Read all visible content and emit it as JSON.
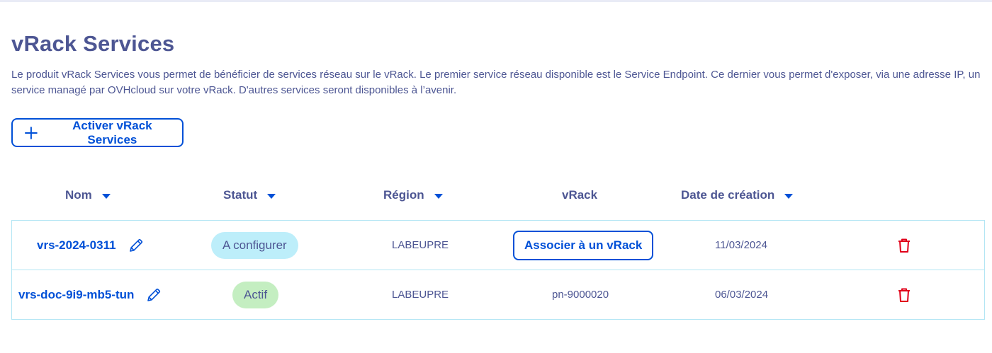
{
  "page": {
    "title": "vRack Services",
    "description": "Le produit vRack Services vous permet de bénéficier de services réseau sur le vRack. Le premier service réseau disponible est le Service Endpoint. Ce dernier vous permet d'exposer, via une adresse IP, un service managé par OVHcloud sur votre vRack. D'autres services seront disponibles à l’avenir.",
    "activate_button": "Activer vRack Services"
  },
  "table": {
    "headers": {
      "name": "Nom",
      "status": "Statut",
      "region": "Région",
      "vrack": "vRack",
      "created": "Date de création"
    },
    "rows": [
      {
        "name": "vrs-2024-0311",
        "status": "A configurer",
        "region": "LABEUPRE",
        "vrack_action": "Associer à un vRack",
        "created": "11/03/2024"
      },
      {
        "name": "vrs-doc-9i9-mb5-tun",
        "status": "Actif",
        "region": "LABEUPRE",
        "vrack": "pn-9000020",
        "created": "06/03/2024"
      }
    ]
  },
  "colors": {
    "primary": "#0050d7",
    "text": "#4d5693",
    "badge_config": "#bdeefa",
    "badge_active": "#c4eec1",
    "danger": "#e0001a",
    "table_border": "#b3e6f4"
  },
  "icons": [
    "plus-icon",
    "pencil-icon",
    "trash-icon",
    "caret-down-icon"
  ]
}
